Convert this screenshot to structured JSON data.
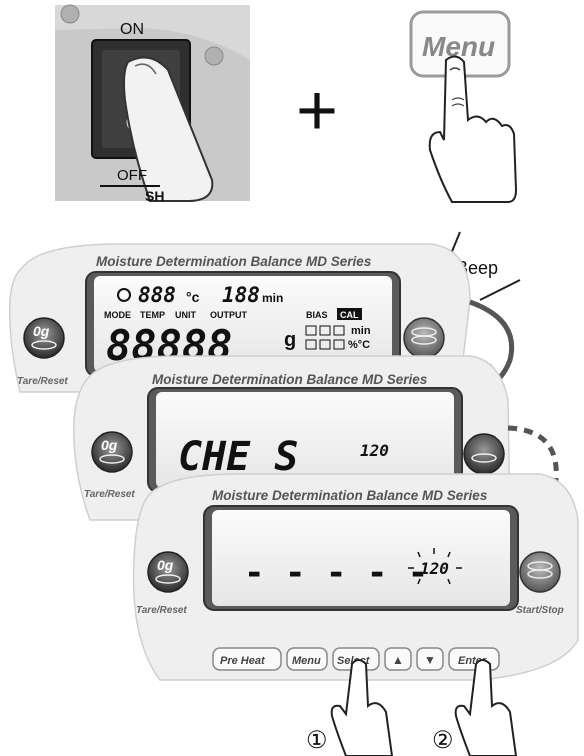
{
  "power_switch": {
    "on_label": "ON",
    "off_label": "OFF",
    "panel_fragment": "SH"
  },
  "plus_symbol": "+",
  "menu_key": {
    "label": "Menu"
  },
  "beep_label": "Beep",
  "panel_title": "Moisture Determination Balance  MD Series",
  "tare_zero_label": "0g",
  "tare_reset_label": "Tare/Reset",
  "start_stop_label": "Start/Stop",
  "screen1": {
    "temp_digits": "888",
    "temp_unit": "°c",
    "min_digits": "188",
    "min_unit": "min",
    "indicator_labels": [
      "MODE",
      "TEMP",
      "UNIT",
      "OUTPUT",
      "BIAS",
      "CAL"
    ],
    "main_digits": "88888",
    "unit_g": "g",
    "unit_pct": "%",
    "small_min": "min",
    "small_pct_c": "%°C"
  },
  "screen2": {
    "main_text": "CHE  S",
    "aux_value": "120"
  },
  "screen3": {
    "main_text": "- - - - -",
    "aux_value": "120"
  },
  "key_row": [
    "Pre Heat",
    "Menu",
    "Select",
    "▲",
    "▼",
    "Enter"
  ],
  "step_markers": [
    "①",
    "②"
  ]
}
